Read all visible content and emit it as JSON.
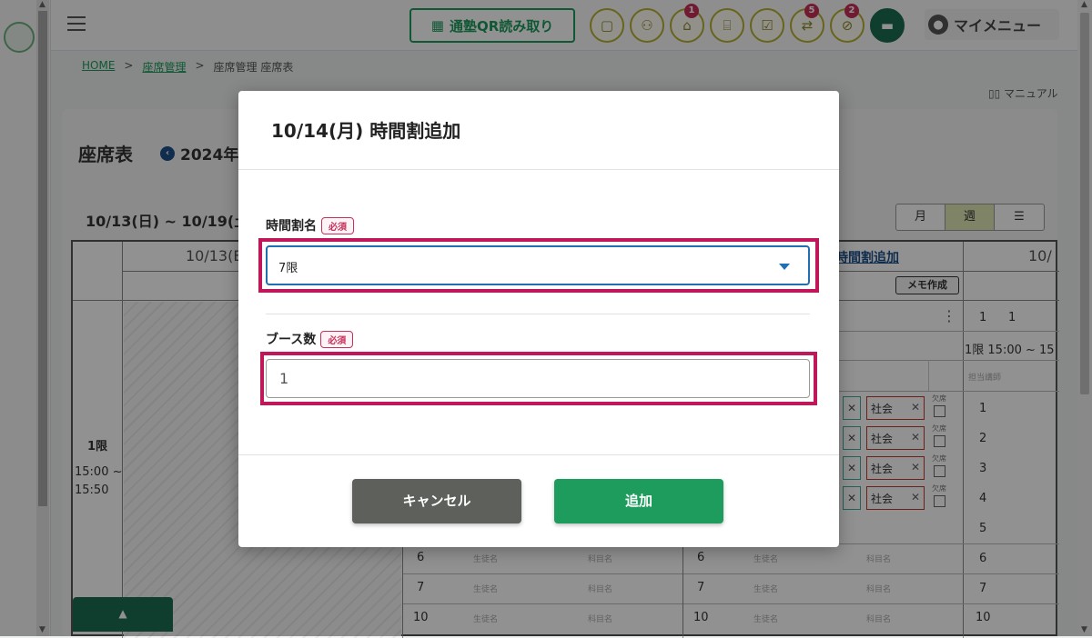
{
  "header": {
    "qr_label": "通塾QR読み取り",
    "badges": [
      "1",
      "5",
      "2"
    ],
    "my_menu": "マイメニュー"
  },
  "breadcrumb": [
    "HOME",
    "座席管理",
    "座席管理 座席表"
  ],
  "breadcrumb_sep": ">",
  "manual": "マニュアル",
  "page": {
    "title": "座席表",
    "year": "2024年",
    "range": "10/13(日) ~ 10/19(土",
    "views": [
      "月",
      "週"
    ]
  },
  "table": {
    "date_head": "10/13(E",
    "date_head2": "10/",
    "add_link": "時間割追加",
    "memo_btn": "メモ作成",
    "numbers": [
      "1",
      "1"
    ],
    "slot_head": "1限 15:00 ~ 15",
    "teacher_head": "担当講師",
    "period": "1限",
    "time_start": "15:00 ~",
    "time_end": "15:50",
    "subject_chip": "社会",
    "absent": "欠席",
    "student_ph": "生徒名",
    "subject_ph": "科目名",
    "row_nums": [
      "6",
      "7",
      "10"
    ],
    "right_nums": [
      "1",
      "2",
      "3",
      "4",
      "5",
      "6",
      "7",
      "10"
    ]
  },
  "modal": {
    "title": "10/14(月) 時間割追加",
    "field1_label": "時間割名",
    "field1_value": "7限",
    "field2_label": "ブース数",
    "field2_value": "1",
    "required": "必須",
    "cancel": "キャンセル",
    "add": "追加"
  },
  "colors": {
    "primary_green": "#1d9c5d",
    "highlight": "#c0175a",
    "cancel_bg": "#5e605b"
  }
}
